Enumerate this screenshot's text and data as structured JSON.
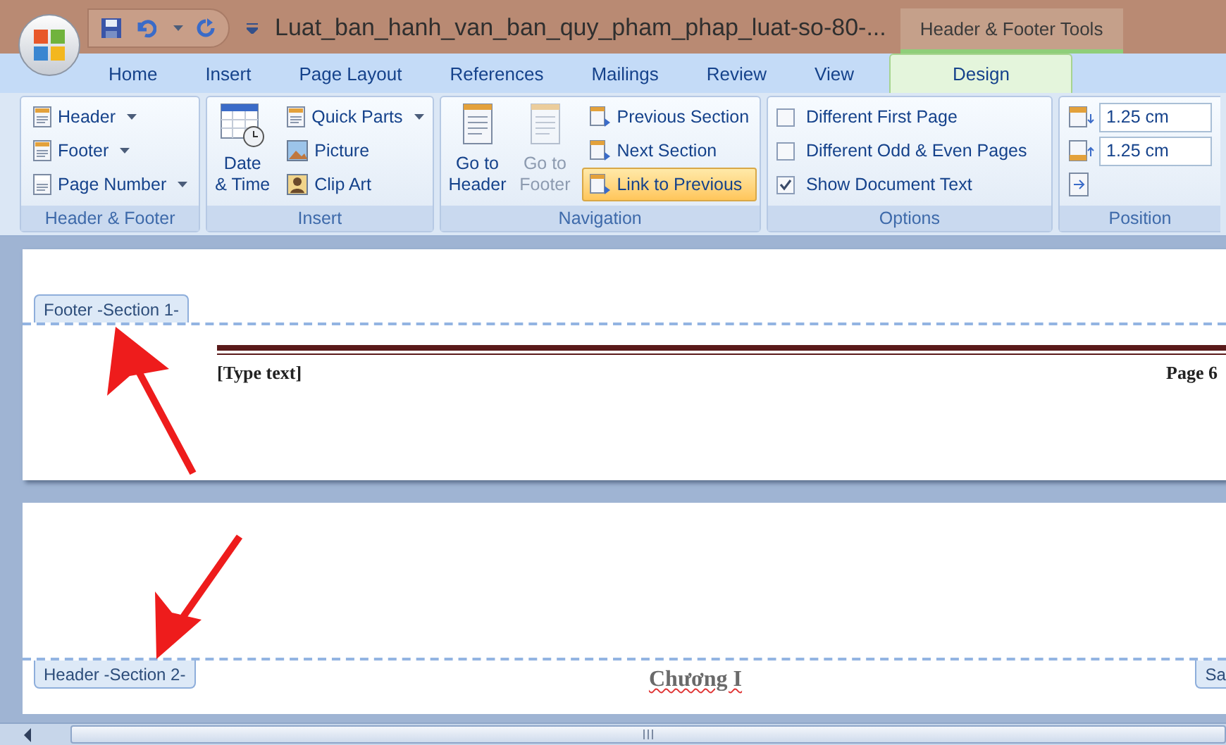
{
  "title_bar": {
    "title": "Luat_ban_hanh_van_ban_quy_pham_phap_luat-so-80-...",
    "context_tab": "Header & Footer Tools"
  },
  "tabs": [
    {
      "label": "Home",
      "selected": false
    },
    {
      "label": "Insert",
      "selected": false
    },
    {
      "label": "Page Layout",
      "selected": false
    },
    {
      "label": "References",
      "selected": false
    },
    {
      "label": "Mailings",
      "selected": false
    },
    {
      "label": "Review",
      "selected": false
    },
    {
      "label": "View",
      "selected": false
    },
    {
      "label": "Design",
      "selected": true
    }
  ],
  "ribbon": {
    "header_footer": {
      "label": "Header & Footer",
      "items": [
        {
          "label": "Header",
          "dropdown": true
        },
        {
          "label": "Footer",
          "dropdown": true
        },
        {
          "label": "Page Number",
          "dropdown": true
        }
      ]
    },
    "insert": {
      "label": "Insert",
      "large": {
        "line1": "Date",
        "line2": "& Time"
      },
      "items": [
        {
          "label": "Quick Parts",
          "dropdown": true
        },
        {
          "label": "Picture",
          "dropdown": false
        },
        {
          "label": "Clip Art",
          "dropdown": false
        }
      ]
    },
    "navigation": {
      "label": "Navigation",
      "large": [
        {
          "line1": "Go to",
          "line2": "Header",
          "disabled": false
        },
        {
          "line1": "Go to",
          "line2": "Footer",
          "disabled": true
        }
      ],
      "items": [
        {
          "label": "Previous Section",
          "selected": false
        },
        {
          "label": "Next Section",
          "selected": false
        },
        {
          "label": "Link to Previous",
          "selected": true
        }
      ]
    },
    "options": {
      "label": "Options",
      "items": [
        {
          "label": "Different First Page",
          "checked": false
        },
        {
          "label": "Different Odd & Even Pages",
          "checked": false
        },
        {
          "label": "Show Document Text",
          "checked": true
        }
      ]
    },
    "position": {
      "label": "Position",
      "fields": [
        {
          "value": "1.25 cm"
        },
        {
          "value": "1.25 cm"
        }
      ]
    }
  },
  "document": {
    "page_1": {
      "tag": "Footer -Section 1-",
      "left_text": "[Type text]",
      "right_text": "Page 6"
    },
    "page_2": {
      "tag": "Header -Section 2-",
      "center_text": "Chương I",
      "right_tag": "Sa"
    }
  }
}
